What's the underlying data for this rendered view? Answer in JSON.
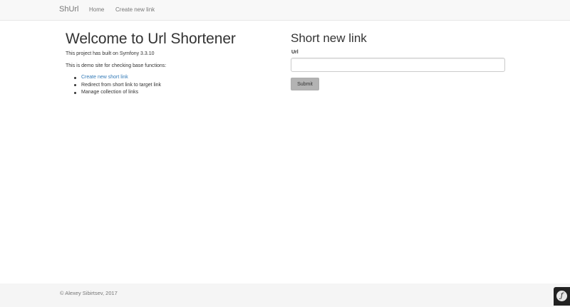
{
  "navbar": {
    "brand": "ShUrl",
    "links": [
      {
        "label": "Home"
      },
      {
        "label": "Create new link"
      }
    ]
  },
  "main": {
    "title": "Welcome to Url Shortener",
    "built_text": "This project has built on Symfony 3.3.10",
    "demo_text": "This is demo site for checking base functions:",
    "features": [
      {
        "label": "Create new short link",
        "is_link": true
      },
      {
        "label": "Redirect from short link to target link",
        "is_link": false
      },
      {
        "label": "Manage collection of links",
        "is_link": false
      }
    ]
  },
  "form": {
    "title": "Short new link",
    "url_label": "Url",
    "url_value": "",
    "submit_label": "Submit"
  },
  "footer": {
    "copyright": "© Alexey Sibirtsev, 2017",
    "toolbar_icon": "symfony-logo-icon"
  },
  "colors": {
    "link": "#337ab7",
    "navbar_bg": "#f8f8f8",
    "footer_bg": "#f5f5f5",
    "button_bg": "#b3b3b3"
  }
}
